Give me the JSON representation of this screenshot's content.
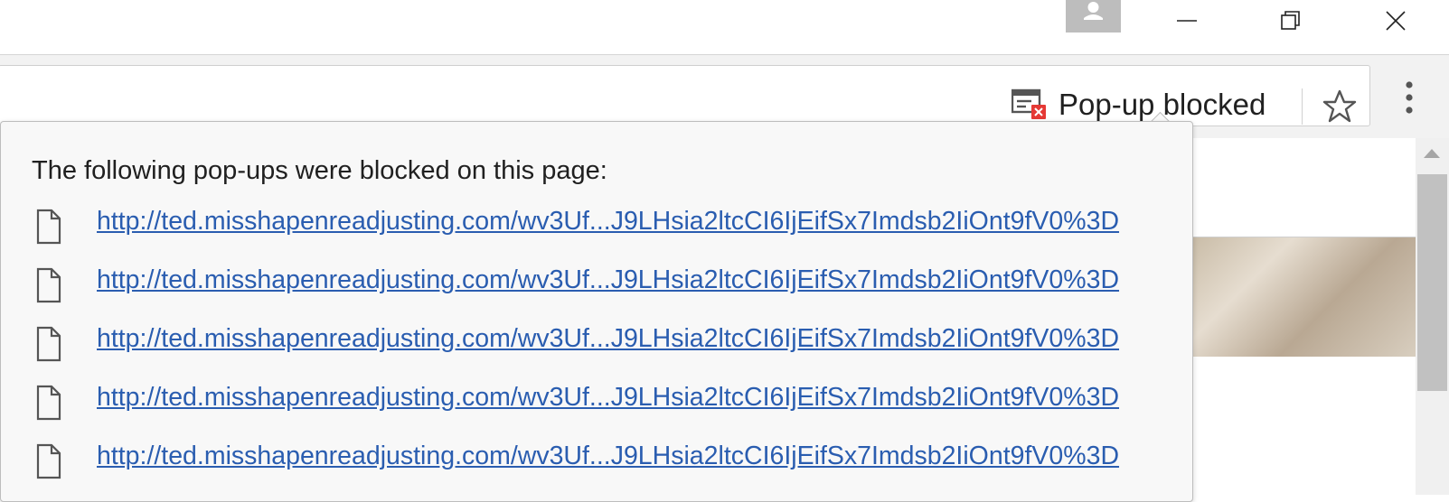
{
  "window": {
    "controls": [
      "minimize-icon",
      "restore-icon",
      "close-icon"
    ]
  },
  "toolbar": {
    "popup_blocked_label": "Pop-up blocked",
    "popup_icon": "popup-blocked-icon",
    "bookmark_icon": "star-icon",
    "menu_icon": "more-vert-icon"
  },
  "bubble": {
    "title": "The following pop-ups were blocked on this page:",
    "links": [
      "http://ted.misshapenreadjusting.com/wv3Uf...J9LHsia2ltcCI6IjEifSx7Imdsb2IiOnt9fV0%3D",
      "http://ted.misshapenreadjusting.com/wv3Uf...J9LHsia2ltcCI6IjEifSx7Imdsb2IiOnt9fV0%3D",
      "http://ted.misshapenreadjusting.com/wv3Uf...J9LHsia2ltcCI6IjEifSx7Imdsb2IiOnt9fV0%3D",
      "http://ted.misshapenreadjusting.com/wv3Uf...J9LHsia2ltcCI6IjEifSx7Imdsb2IiOnt9fV0%3D",
      "http://ted.misshapenreadjusting.com/wv3Uf...J9LHsia2ltcCI6IjEifSx7Imdsb2IiOnt9fV0%3D"
    ]
  },
  "colors": {
    "link": "#2a5db0",
    "blocked_badge": "#e53935",
    "bubble_bg": "#f8f8f8"
  }
}
